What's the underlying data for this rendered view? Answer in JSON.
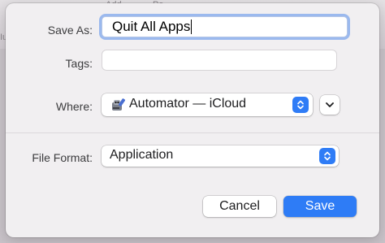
{
  "background_window": {
    "fragments": [
      "Add",
      "Pa",
      "Iu"
    ]
  },
  "dialog": {
    "save_as": {
      "label": "Save As:",
      "value": "Quit All Apps"
    },
    "tags": {
      "label": "Tags:",
      "value": ""
    },
    "where": {
      "label": "Where:",
      "value": "Automator — iCloud",
      "icon": "automator-app-icon"
    },
    "file_format": {
      "label": "File Format:",
      "value": "Application"
    },
    "buttons": {
      "cancel": "Cancel",
      "save": "Save"
    }
  },
  "colors": {
    "accent": "#2e7cf6",
    "focus_ring": "#9bb9ee",
    "sheet_background": "#f1eff1"
  }
}
